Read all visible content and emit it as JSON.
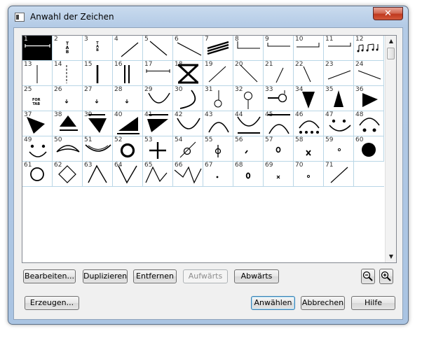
{
  "window": {
    "title": "Anwahl der Zeichen",
    "close_label": "✕"
  },
  "icons": {
    "app": "window-icon",
    "zoom_out": "zoom-out-icon",
    "zoom_in": "zoom-in-icon",
    "scroll_up": "▲",
    "scroll_down": "▼"
  },
  "symbols": [
    {
      "n": "1",
      "shape": "bracket-h"
    },
    {
      "n": "2",
      "shape": "tab-big",
      "text": "T\nA\nB"
    },
    {
      "n": "3",
      "shape": "tab-small",
      "text": "T\nA\nB"
    },
    {
      "n": "4",
      "shape": "diag-up"
    },
    {
      "n": "5",
      "shape": "diag-down"
    },
    {
      "n": "6",
      "shape": "diag-down-long"
    },
    {
      "n": "7",
      "shape": "triple-slant"
    },
    {
      "n": "8",
      "shape": "corner-up-left"
    },
    {
      "n": "9",
      "shape": "corner-up-left-2"
    },
    {
      "n": "10",
      "shape": "corner-up-right"
    },
    {
      "n": "11",
      "shape": "corner-up-right-2"
    },
    {
      "n": "12",
      "shape": "notes"
    },
    {
      "n": "13",
      "shape": "vline-thin"
    },
    {
      "n": "14",
      "shape": "vline-dashed"
    },
    {
      "n": "15",
      "shape": "vline-thick"
    },
    {
      "n": "16",
      "shape": "vline-double"
    },
    {
      "n": "17",
      "shape": "bracket-h2"
    },
    {
      "n": "18",
      "shape": "xbox"
    },
    {
      "n": "19",
      "shape": "diag-up-2"
    },
    {
      "n": "20",
      "shape": "diag-down-2"
    },
    {
      "n": "21",
      "shape": "diag-up-steep"
    },
    {
      "n": "22",
      "shape": "diag-down-steep"
    },
    {
      "n": "23",
      "shape": "diag-up-flat"
    },
    {
      "n": "24",
      "shape": "diag-down-flat"
    },
    {
      "n": "25",
      "shape": "fortab",
      "text": "FOR\nTAB"
    },
    {
      "n": "26",
      "shape": "tiny-arrow"
    },
    {
      "n": "27",
      "shape": "tiny-arrow"
    },
    {
      "n": "28",
      "shape": "tiny-arrow"
    },
    {
      "n": "29",
      "shape": "smile-arc"
    },
    {
      "n": "30",
      "shape": "arc-right"
    },
    {
      "n": "31",
      "shape": "lollipop"
    },
    {
      "n": "32",
      "shape": "lollipop-2"
    },
    {
      "n": "33",
      "shape": "circle-line"
    },
    {
      "n": "34",
      "shape": "tri-down"
    },
    {
      "n": "35",
      "shape": "tri-up"
    },
    {
      "n": "36",
      "shape": "tri-right"
    },
    {
      "n": "37",
      "shape": "tri-down-left"
    },
    {
      "n": "38",
      "shape": "tri-up-bar"
    },
    {
      "n": "39",
      "shape": "tri-bar-down"
    },
    {
      "n": "40",
      "shape": "wedge-bar"
    },
    {
      "n": "41",
      "shape": "bar-tri-down"
    },
    {
      "n": "42",
      "shape": "arc-up"
    },
    {
      "n": "43",
      "shape": "arc-down"
    },
    {
      "n": "44",
      "shape": "bowl-bar"
    },
    {
      "n": "45",
      "shape": "bar-arch"
    },
    {
      "n": "46",
      "shape": "arch-dots"
    },
    {
      "n": "47",
      "shape": "dots-smile"
    },
    {
      "n": "48",
      "shape": "arch-dot-pair"
    },
    {
      "n": "49",
      "shape": "smiley"
    },
    {
      "n": "50",
      "shape": "lens"
    },
    {
      "n": "51",
      "shape": "wide-smile"
    },
    {
      "n": "52",
      "shape": "ring"
    },
    {
      "n": "53",
      "shape": "plus"
    },
    {
      "n": "54",
      "shape": "circle-slash"
    },
    {
      "n": "55",
      "shape": "phi"
    },
    {
      "n": "56",
      "shape": "tiny-dash"
    },
    {
      "n": "57",
      "shape": "small-ring"
    },
    {
      "n": "58",
      "shape": "tiny-x"
    },
    {
      "n": "59",
      "shape": "tiny-o"
    },
    {
      "n": "60",
      "shape": "filled-ring"
    },
    {
      "n": "61",
      "shape": "big-ring"
    },
    {
      "n": "62",
      "shape": "diamond"
    },
    {
      "n": "63",
      "shape": "caret-up"
    },
    {
      "n": "64",
      "shape": "caret-down"
    },
    {
      "n": "65",
      "shape": "zigzag"
    },
    {
      "n": "66",
      "shape": "zigzag-2"
    },
    {
      "n": "67",
      "shape": "tiny-dot"
    },
    {
      "n": "68",
      "shape": "small-ring-2"
    },
    {
      "n": "69",
      "shape": "tiny-x-2"
    },
    {
      "n": "70",
      "shape": "tiny-o-2"
    },
    {
      "n": "71",
      "shape": "diag-up-3"
    }
  ],
  "buttons": {
    "edit": "Bearbeiten...",
    "duplicate": "Duplizieren",
    "remove": "Entfernen",
    "up": "Aufwärts",
    "down": "Abwärts",
    "create": "Erzeugen...",
    "select": "Anwählen",
    "cancel": "Abbrechen",
    "help": "Hilfe"
  }
}
